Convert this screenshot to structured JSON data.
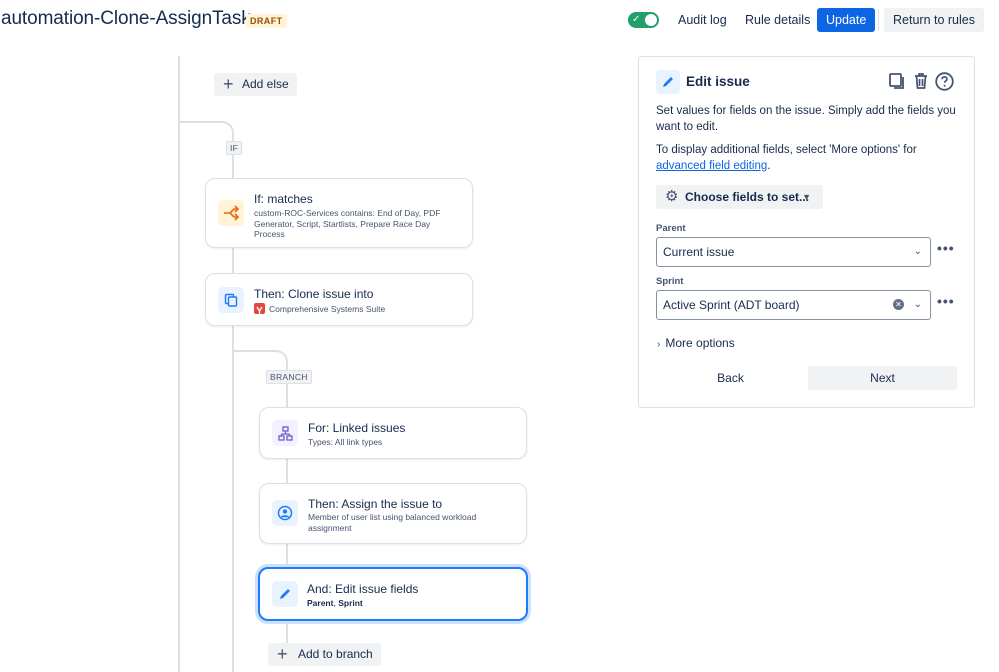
{
  "header": {
    "title": "automation-Clone-AssignTask",
    "status": "DRAFT",
    "audit_log": "Audit log",
    "rule_details": "Rule details",
    "update": "Update",
    "return_to_rules": "Return to rules",
    "toggle_enabled": true
  },
  "flow": {
    "add_else": "Add else",
    "if_label": "IF",
    "branch_label": "BRANCH",
    "add_to_branch": "Add to branch",
    "cards": [
      {
        "title": "If: matches",
        "subtitle": "custom-ROC-Services contains: End of Day, PDF Generator, Script, Startlists, Prepare Race Day Process",
        "icon": "branch-condition-icon"
      },
      {
        "title": "Then: Clone issue into",
        "subtitle": "Comprehensive Systems Suite",
        "icon": "copy-icon"
      },
      {
        "title": "For: Linked issues",
        "subtitle": "Types: All link types",
        "icon": "hierarchy-icon"
      },
      {
        "title": "Then: Assign the issue to",
        "subtitle": "Member of user list using balanced workload assignment",
        "icon": "user-icon"
      },
      {
        "title": "And: Edit issue fields",
        "subtitle_parent": "Parent",
        "subtitle_comma": ", ",
        "subtitle_sprint": "Sprint",
        "icon": "pencil-icon"
      }
    ]
  },
  "panel": {
    "title": "Edit issue",
    "desc1": "Set values for fields on the issue. Simply add the fields you want to edit.",
    "desc2_prefix": "To display additional fields, select 'More options' for ",
    "desc2_link": "advanced field editing",
    "desc2_suffix": ".",
    "choose_fields": "Choose fields to set...",
    "parent_label": "Parent",
    "parent_value": "Current issue",
    "sprint_label": "Sprint",
    "sprint_value": "Active Sprint (ADT board)",
    "more_options": "More options",
    "back": "Back",
    "next": "Next"
  },
  "colors": {
    "primary": "#0c66e4",
    "toggle_on": "#22a06b",
    "selected_border": "#1d7afc",
    "condition_icon_bg": "#fff4d6",
    "action_icon_bg": "#e9f2ff",
    "branch_icon_bg": "#f3f0ff"
  }
}
